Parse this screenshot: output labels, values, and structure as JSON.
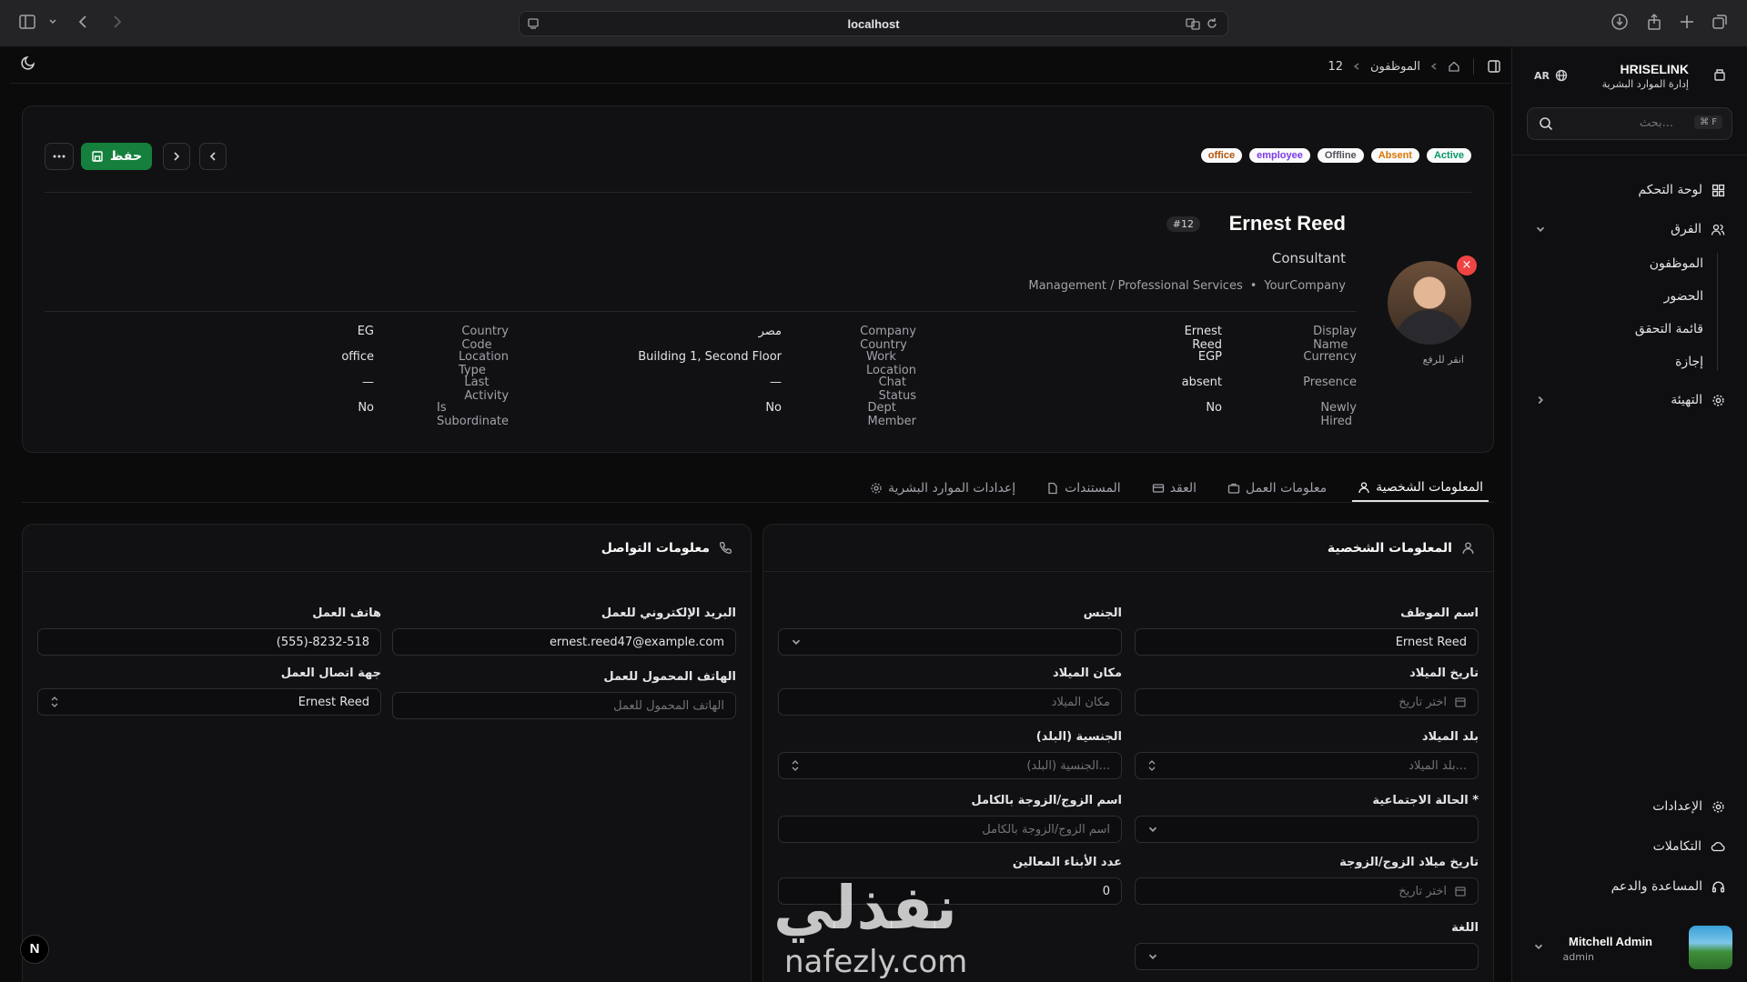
{
  "browser": {
    "url": "localhost"
  },
  "breadcrumb": {
    "section": "الموظفون",
    "current": "12"
  },
  "toolbar": {
    "save_label": "حفظ"
  },
  "badges": [
    {
      "label": "Active",
      "color": "#059669"
    },
    {
      "label": "Absent",
      "color": "#d97706"
    },
    {
      "label": "Offline",
      "color": "#52525b"
    },
    {
      "label": "employee",
      "color": "#7c3aed"
    },
    {
      "label": "office",
      "color": "#b45309"
    }
  ],
  "employee": {
    "name": "Ernest Reed",
    "id_badge": "#12",
    "job_title": "Consultant",
    "company": "YourCompany",
    "department": "Management / Professional Services",
    "upload_hint": "انقر للرفع"
  },
  "info": {
    "display_name_label": "Display Name",
    "display_name": "Ernest Reed",
    "currency_label": "Currency",
    "currency": "EGP",
    "presence_label": "Presence",
    "presence": "absent",
    "newly_hired_label": "Newly Hired",
    "newly_hired": "No",
    "company_country_label": "Company Country",
    "company_country": "مصر",
    "work_location_label": "Work Location",
    "work_location": "Building 1, Second Floor",
    "chat_status_label": "Chat Status",
    "chat_status": "—",
    "dept_member_label": "Dept Member",
    "dept_member": "No",
    "country_code_label": "Country Code",
    "country_code": "EG",
    "location_type_label": "Location Type",
    "location_type": "office",
    "last_activity_label": "Last Activity",
    "last_activity": "—",
    "is_subordinate_label": "Is Subordinate",
    "is_subordinate": "No"
  },
  "tabs": [
    {
      "label": "المعلومات الشخصية",
      "active": true,
      "icon": "user-icon"
    },
    {
      "label": "معلومات العمل",
      "active": false,
      "icon": "briefcase-icon"
    },
    {
      "label": "العقد",
      "active": false,
      "icon": "card-icon"
    },
    {
      "label": "المستندات",
      "active": false,
      "icon": "file-icon"
    },
    {
      "label": "إعدادات الموارد البشرية",
      "active": false,
      "icon": "gear-icon"
    }
  ],
  "personal": {
    "title": "المعلومات الشخصية",
    "employee_name_label": "اسم الموظف",
    "employee_name": "Ernest Reed",
    "gender_label": "الجنس",
    "birthday_label": "تاريخ الميلاد",
    "birthday_ph": "اختر تاريخ",
    "birthplace_label": "مكان الميلاد",
    "birthplace_ph": "مكان الميلاد",
    "birth_country_label": "بلد الميلاد",
    "birth_country_ph": "بلد الميلاد...",
    "nationality_label": "الجنسية (البلد)",
    "nationality_ph": "الجنسية (البلد)...",
    "marital_label": "الحالة الاجتماعية *",
    "spouse_name_label": "اسم الزوج/الزوجة بالكامل",
    "spouse_name_ph": "اسم الزوج/الزوجة بالكامل",
    "spouse_birth_label": "تاريخ ميلاد الزوج/الزوجة",
    "spouse_birth_ph": "اختر تاريخ",
    "children_label": "عدد الأبناء المعالين",
    "children": "0",
    "lang_label": "اللغة"
  },
  "contact": {
    "title": "معلومات التواصل",
    "work_email_label": "البريد الإلكتروني للعمل",
    "work_email": "ernest.reed47@example.com",
    "work_phone_label": "هاتف العمل",
    "work_phone": "(555)-8232-518",
    "mobile_label": "الهاتف المحمول للعمل",
    "mobile_ph": "الهاتف المحمول للعمل",
    "work_contact_label": "جهة اتصال العمل",
    "work_contact": "Ernest Reed"
  },
  "sidebar": {
    "brand_name": "HRISELINK",
    "brand_sub": "إدارة الموارد البشرية",
    "lang": "AR",
    "search_ph": "بحث...",
    "search_kbd": "⌘ F",
    "dashboard": "لوحة التحكم",
    "teams": "الفرق",
    "employees": "الموظفون",
    "attendance": "الحضور",
    "checklist": "قائمة التحقق",
    "leave": "إجازة",
    "onboarding": "التهيئة",
    "settings": "الإعدادات",
    "integrations": "التكاملات",
    "help": "المساعدة والدعم",
    "user_name": "Mitchell Admin",
    "user_role": "admin"
  },
  "watermark": {
    "ar": "نفذلي",
    "en": "nafezly.com"
  }
}
